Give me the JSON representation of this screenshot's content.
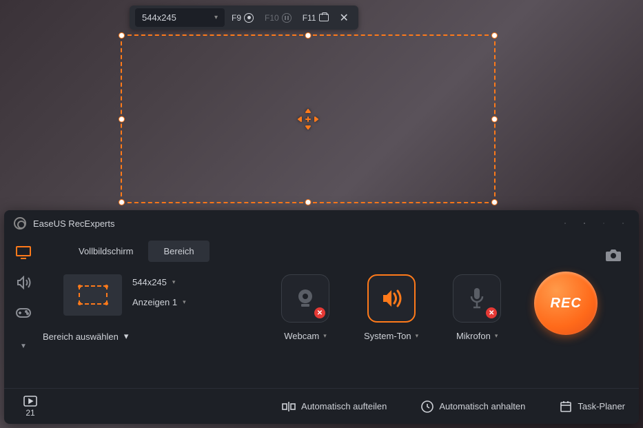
{
  "toolbar": {
    "resolution": "544x245",
    "hotkeys": {
      "record": "F9",
      "pause": "F10",
      "screenshot": "F11"
    }
  },
  "panel": {
    "title": "EaseUS RecExperts",
    "tabs": {
      "fullscreen": "Vollbildschirm",
      "region": "Bereich"
    },
    "area": {
      "resolution": "544x245",
      "display": "Anzeigen 1",
      "select_label": "Bereich auswählen"
    },
    "sources": {
      "webcam": "Webcam",
      "system": "System-Ton",
      "mic": "Mikrofon"
    },
    "rec_label": "REC",
    "footer": {
      "file_count": "21",
      "auto_split": "Automatisch aufteilen",
      "auto_stop": "Automatisch anhalten",
      "task_planner": "Task-Planer"
    }
  }
}
